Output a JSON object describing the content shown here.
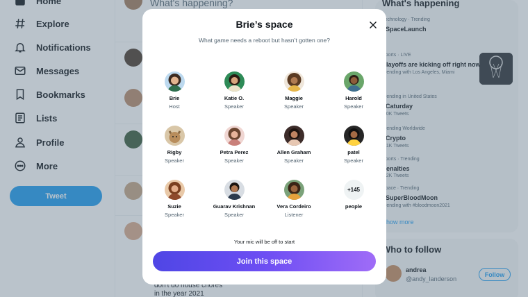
{
  "sidebar": {
    "items": [
      {
        "label": "Home",
        "icon": "home-icon"
      },
      {
        "label": "Explore",
        "icon": "hashtag-icon"
      },
      {
        "label": "Notifications",
        "icon": "bell-icon"
      },
      {
        "label": "Messages",
        "icon": "envelope-icon"
      },
      {
        "label": "Bookmarks",
        "icon": "bookmark-icon"
      },
      {
        "label": "Lists",
        "icon": "list-icon"
      },
      {
        "label": "Profile",
        "icon": "person-icon"
      },
      {
        "label": "More",
        "icon": "more-icon"
      }
    ],
    "tweet_label": "Tweet"
  },
  "timeline": {
    "compose_placeholder": "What's happening?",
    "tweet_text_line1": "don't do house chores",
    "tweet_text_line2": "in the year 2021"
  },
  "right": {
    "trends_title": "What's happening",
    "trends": [
      {
        "meta": "Technology · Trending",
        "name": "#SpaceLaunch",
        "sub": ""
      },
      {
        "meta": "Sports · LIVE",
        "name": "Playoffs are kicking off right now",
        "sub": "Trending with Los Angeles, Miami"
      },
      {
        "meta": "Trending in United States",
        "name": "#Caturday",
        "sub": "1.0K Tweets"
      },
      {
        "meta": "Trending Worldwide",
        "name": "#Crypto",
        "sub": "1.1K Tweets"
      },
      {
        "meta": "Sports · Trending",
        "name": "Penalties",
        "sub": "3.2K Tweets"
      },
      {
        "meta": "Space · Trending",
        "name": "#SuperBloodMoon",
        "sub": "Trending with #bloodmoon2021"
      }
    ],
    "show_more": "Show more",
    "who_to_follow_title": "Who to follow",
    "follow_name": "andrea",
    "follow_handle": "@andy_landerson",
    "follow_label": "Follow"
  },
  "modal": {
    "title": "Brie’s space",
    "subtitle": "What game needs a reboot but hasn’t gotten one?",
    "participants": [
      {
        "name": "Brie",
        "role": "Host"
      },
      {
        "name": "Katie O.",
        "role": "Speaker"
      },
      {
        "name": "Maggie",
        "role": "Speaker"
      },
      {
        "name": "Harold",
        "role": "Speaker"
      },
      {
        "name": "Rigby",
        "role": "Speaker"
      },
      {
        "name": "Petra Perez",
        "role": "Speaker"
      },
      {
        "name": "Allen Graham",
        "role": "Speaker"
      },
      {
        "name": "patel",
        "role": "Speaker"
      },
      {
        "name": "Suzie",
        "role": "Speaker"
      },
      {
        "name": "Guarav Krishnan",
        "role": "Speaker"
      },
      {
        "name": "Vera Cordeiro",
        "role": "Listener"
      }
    ],
    "more_count": "+145",
    "more_label": "people",
    "mic_note": "Your mic will be off to start",
    "join_label": "Join this space"
  },
  "colors": {
    "accent": "#1d9bf0",
    "join_gradient_start": "#4f46e5",
    "join_gradient_end": "#9f6cf7",
    "overlay": "#5b7083"
  }
}
